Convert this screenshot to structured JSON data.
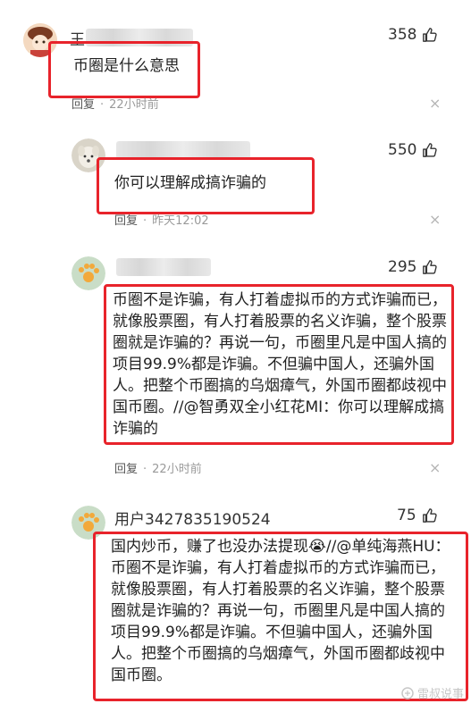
{
  "comments": [
    {
      "author": "王",
      "likes": "358",
      "text": "币圈是什么意思",
      "reply_label": "回复",
      "time": "22小时前"
    },
    {
      "author": "",
      "likes": "550",
      "text": "你可以理解成搞诈骗的",
      "reply_label": "回复",
      "time": "昨天12:02"
    },
    {
      "author": "",
      "likes": "295",
      "text": "币圈不是诈骗，有人打着虚拟币的方式诈骗而已，就像股票圈，有人打着股票的名义诈骗，整个股票圈就是诈骗的？再说一句，币圈里凡是中国人搞的项目99.9%都是诈骗。不但骗中国人，还骗外国人。把整个币圈搞的乌烟瘴气，外国币圈都歧视中国币圈。//@智勇双全小红花MI：你可以理解成搞诈骗的",
      "reply_label": "回复",
      "time": "22小时前"
    },
    {
      "author": "用户3427835190524",
      "likes": "75",
      "text": "国内炒币，赚了也没办法提现😭//@单纯海燕HU：币圈不是诈骗，有人打着虚拟币的方式诈骗而已，就像股票圈，有人打着股票的名义诈骗，整个股票圈就是诈骗的？再说一句，币圈里凡是中国人搞的项目99.9%都是诈骗。不但骗中国人，还骗外国人。把整个币圈搞的乌烟瘴气，外国币圈都歧视中国币圈。"
    }
  ],
  "separator": "·",
  "close_glyph": "×",
  "watermark": "雷叔说事",
  "colors": {
    "highlight": "#e8232b",
    "meta": "#9a9a9a"
  }
}
